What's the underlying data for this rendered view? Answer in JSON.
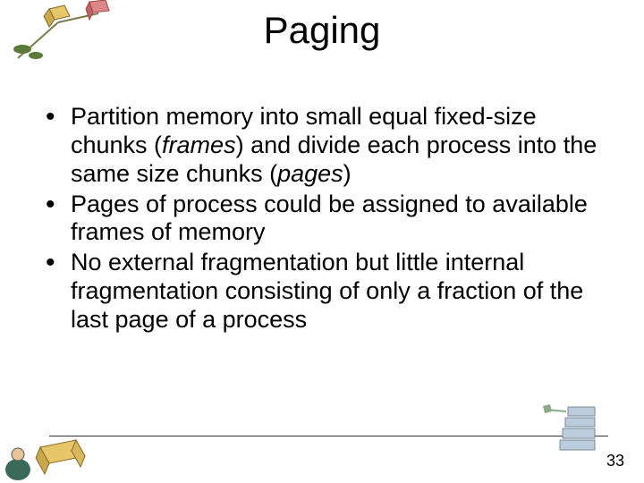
{
  "title": "Paging",
  "bullets": [
    {
      "pre": "Partition memory into small equal fixed-size chunks (",
      "em1": "frames",
      "mid": ") and divide each process into the same size chunks (",
      "em2": "pages",
      "post": ")"
    },
    {
      "text": "Pages of process could be assigned to available frames of memory"
    },
    {
      "text": "No external fragmentation but little internal fragmentation consisting of only a fraction of the last page of a process"
    }
  ],
  "page_number": "33",
  "icons": {
    "top_left": "clipart-cubes-top-left",
    "bottom_left": "clipart-reading-box",
    "bottom_right": "clipart-server-small"
  }
}
